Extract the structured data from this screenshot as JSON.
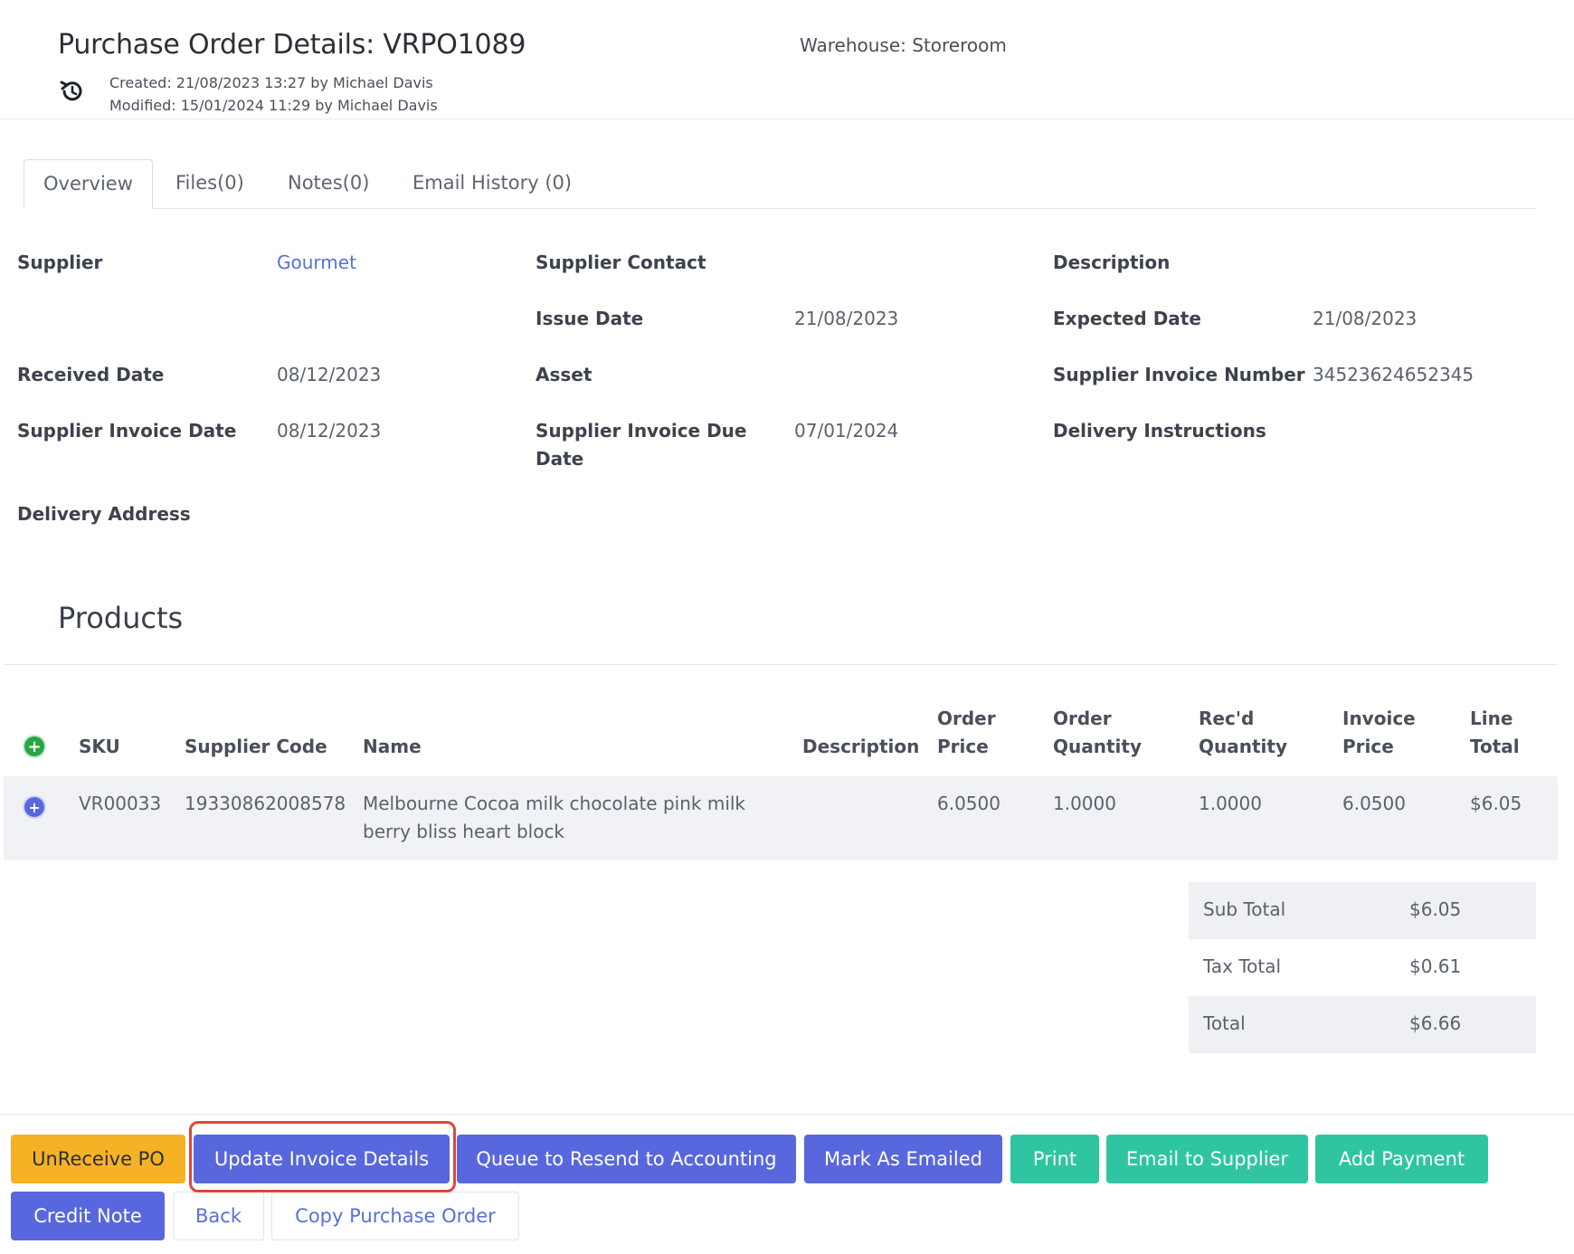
{
  "header": {
    "title": "Purchase Order Details: VRPO1089",
    "created": "Created: 21/08/2023 13:27 by Michael Davis",
    "modified": "Modified: 15/01/2024 11:29 by Michael Davis",
    "warehouse": "Warehouse: Storeroom",
    "history_icon": "history-icon"
  },
  "tabs": [
    {
      "label": "Overview",
      "active": true
    },
    {
      "label": "Files(0)",
      "active": false
    },
    {
      "label": "Notes(0)",
      "active": false
    },
    {
      "label": "Email History (0)",
      "active": false
    }
  ],
  "details": {
    "supplier_label": "Supplier",
    "supplier_value": "Gourmet",
    "supplier_contact_label": "Supplier Contact",
    "description_label": "Description",
    "issue_date_label": "Issue Date",
    "issue_date_value": "21/08/2023",
    "expected_date_label": "Expected Date",
    "expected_date_value": "21/08/2023",
    "received_date_label": "Received Date",
    "received_date_value": "08/12/2023",
    "asset_label": "Asset",
    "supplier_invoice_number_label": "Supplier Invoice Number",
    "supplier_invoice_number_value": "34523624652345",
    "supplier_invoice_date_label": "Supplier Invoice Date",
    "supplier_invoice_date_value": "08/12/2023",
    "supplier_invoice_due_label_1": "Supplier Invoice Due",
    "supplier_invoice_due_label_2": "Date",
    "supplier_invoice_due_value": "07/01/2024",
    "delivery_instructions_label": "Delivery Instructions",
    "delivery_address_label": "Delivery Address"
  },
  "products": {
    "title": "Products",
    "headers": {
      "sku": "SKU",
      "supplier_code": "Supplier Code",
      "name": "Name",
      "description": "Description",
      "order_price_1": "Order",
      "order_price_2": "Price",
      "order_qty_1": "Order",
      "order_qty_2": "Quantity",
      "recd_qty_1": "Rec'd",
      "recd_qty_2": "Quantity",
      "invoice_price_1": "Invoice",
      "invoice_price_2": "Price",
      "line_total_1": "Line",
      "line_total_2": "Total"
    },
    "rows": [
      {
        "sku": "VR00033",
        "supplier_code": "19330862008578",
        "name_line1": "Melbourne Cocoa milk chocolate pink milk",
        "name_line2": "berry bliss heart block",
        "description": "",
        "order_price": "6.0500",
        "order_quantity": "1.0000",
        "recd_quantity": "1.0000",
        "invoice_price": "6.0500",
        "line_total": "$6.05"
      }
    ]
  },
  "totals": {
    "sub_total_label": "Sub Total",
    "sub_total_value": "$6.05",
    "tax_total_label": "Tax Total",
    "tax_total_value": "$0.61",
    "total_label": "Total",
    "total_value": "$6.66"
  },
  "actions": {
    "unreceive": "UnReceive PO",
    "update_invoice": "Update Invoice Details",
    "queue_resend": "Queue to Resend to Accounting",
    "mark_emailed": "Mark As Emailed",
    "print": "Print",
    "email_supplier": "Email to Supplier",
    "add_payment": "Add Payment",
    "credit_note": "Credit Note",
    "back": "Back",
    "copy_po": "Copy Purchase Order"
  },
  "colors": {
    "primary": "#5867dd",
    "success": "#2fc5a0",
    "warning": "#f7b125",
    "highlight": "#e0463a",
    "add_icon": "#28a745"
  }
}
